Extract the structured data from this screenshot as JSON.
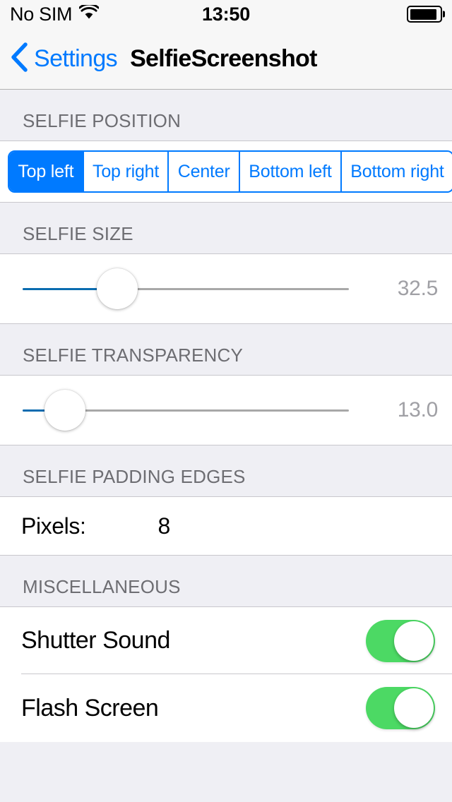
{
  "status_bar": {
    "carrier": "No SIM",
    "wifi_icon": "wifi-icon",
    "time": "13:50",
    "battery_icon": "battery-icon",
    "battery_level_percent": 92
  },
  "nav_bar": {
    "back_icon": "chevron-left-icon",
    "back_label": "Settings",
    "title": "SelfieScreenshot"
  },
  "sections": {
    "position": {
      "header": "SELFIE POSITION",
      "segments": [
        {
          "label": "Top left",
          "selected": true
        },
        {
          "label": "Top right",
          "selected": false
        },
        {
          "label": "Center",
          "selected": false
        },
        {
          "label": "Bottom left",
          "selected": false
        },
        {
          "label": "Bottom right",
          "selected": false
        }
      ]
    },
    "size": {
      "header": "SELFIE SIZE",
      "value": "32.5",
      "fill_percent": 29
    },
    "transparency": {
      "header": "SELFIE TRANSPARENCY",
      "value": "13.0",
      "fill_percent": 13
    },
    "padding": {
      "header": "SELFIE PADDING EDGES",
      "label": "Pixels:",
      "value": "8"
    },
    "miscellaneous": {
      "header": "MISCELLANEOUS",
      "rows": [
        {
          "label": "Shutter Sound",
          "on": true
        },
        {
          "label": "Flash Screen",
          "on": true
        }
      ]
    }
  },
  "colors": {
    "tint": "#007AFF",
    "switch_on": "#4CD964",
    "slider_fill": "#0B6CB0",
    "group_background": "#EFEFF4",
    "header_text": "#6D6D72"
  }
}
